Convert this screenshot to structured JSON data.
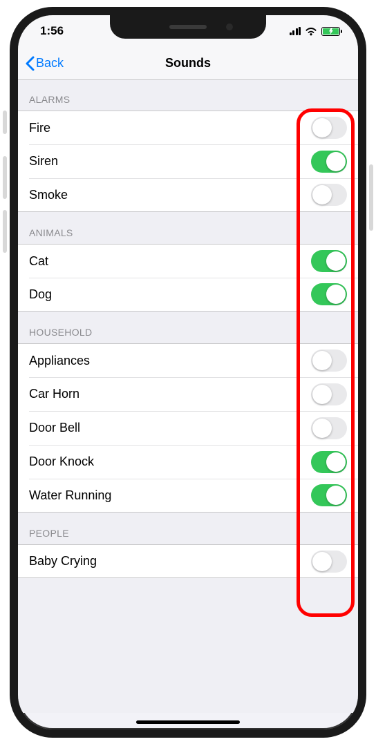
{
  "status": {
    "time": "1:56"
  },
  "nav": {
    "back": "Back",
    "title": "Sounds"
  },
  "sections": [
    {
      "header": "ALARMS",
      "items": [
        {
          "label": "Fire",
          "on": false
        },
        {
          "label": "Siren",
          "on": true
        },
        {
          "label": "Smoke",
          "on": false
        }
      ]
    },
    {
      "header": "ANIMALS",
      "items": [
        {
          "label": "Cat",
          "on": true
        },
        {
          "label": "Dog",
          "on": true
        }
      ]
    },
    {
      "header": "HOUSEHOLD",
      "items": [
        {
          "label": "Appliances",
          "on": false
        },
        {
          "label": "Car Horn",
          "on": false
        },
        {
          "label": "Door Bell",
          "on": false
        },
        {
          "label": "Door Knock",
          "on": true
        },
        {
          "label": "Water Running",
          "on": true
        }
      ]
    },
    {
      "header": "PEOPLE",
      "items": [
        {
          "label": "Baby Crying",
          "on": false
        }
      ]
    }
  ],
  "colors": {
    "accent": "#007aff",
    "switch_on": "#34c759",
    "annotation": "#ff0000"
  }
}
